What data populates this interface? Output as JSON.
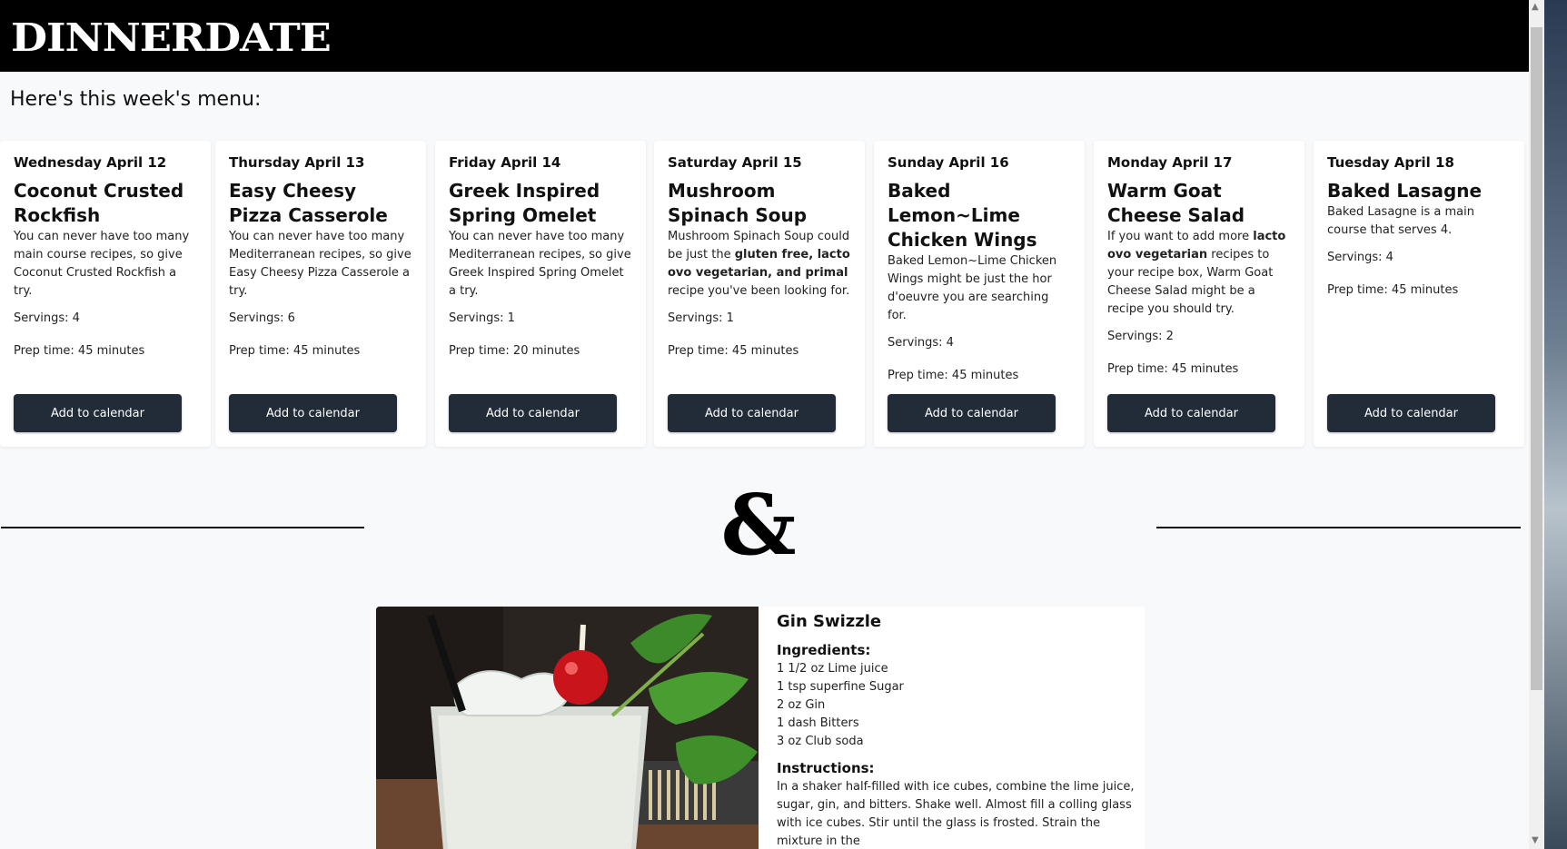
{
  "app": {
    "logo": "DINNERDATE"
  },
  "menu": {
    "heading": "Here's this week's menu:",
    "button_label": "Add to calendar",
    "cards": [
      {
        "day": "Wednesday April 12",
        "title": "Coconut Crusted Rockfish",
        "desc_html": "You can never have too many main course recipes, so give Coconut Crusted Rockfish a try.",
        "servings": "Servings: 4",
        "prep": "Prep time: 45 minutes"
      },
      {
        "day": "Thursday April 13",
        "title": "Easy Cheesy Pizza Casserole",
        "desc_html": "You can never have too many Mediterranean recipes, so give Easy Cheesy Pizza Casserole a try.",
        "servings": "Servings: 6",
        "prep": "Prep time: 45 minutes"
      },
      {
        "day": "Friday April 14",
        "title": "Greek Inspired Spring Omelet",
        "desc_html": "You can never have too many Mediterranean recipes, so give Greek Inspired Spring Omelet a try.",
        "servings": "Servings: 1",
        "prep": "Prep time: 20 minutes"
      },
      {
        "day": "Saturday April 15",
        "title": "Mushroom Spinach Soup",
        "desc_html": "Mushroom Spinach Soup could be just the <b>gluten free, lacto ovo vegetarian, and primal</b> recipe you've been looking for.",
        "servings": "Servings: 1",
        "prep": "Prep time: 45 minutes"
      },
      {
        "day": "Sunday April 16",
        "title": "Baked Lemon~Lime Chicken Wings",
        "desc_html": "Baked Lemon~Lime Chicken Wings might be just the hor d'oeuvre you are searching for.",
        "servings": "Servings: 4",
        "prep": "Prep time: 45 minutes"
      },
      {
        "day": "Monday April 17",
        "title": "Warm Goat Cheese Salad",
        "desc_html": "If you want to add more <b>lacto ovo vegetarian</b> recipes to your recipe box, Warm Goat Cheese Salad might be a recipe you should try.",
        "servings": "Servings: 2",
        "prep": "Prep time: 45 minutes"
      },
      {
        "day": "Tuesday April 18",
        "title": "Baked Lasagne",
        "desc_html": "Baked Lasagne is a main course that serves 4.",
        "servings": "Servings: 4",
        "prep": "Prep time: 45 minutes"
      }
    ]
  },
  "separator": {
    "symbol": "&"
  },
  "drink": {
    "name": "Gin Swizzle",
    "ingredients_label": "Ingredients:",
    "ingredients": [
      "1 1/2 oz Lime juice",
      "1 tsp superfine Sugar",
      "2 oz Gin",
      "1 dash Bitters",
      "3 oz Club soda"
    ],
    "instructions_label": "Instructions:",
    "instructions": "In a shaker half-filled with ice cubes, combine the lime juice, sugar, gin, and bitters. Shake well. Almost fill a colling glass with ice cubes. Stir until the glass is frosted. Strain the mixture in the"
  },
  "colors": {
    "header_bg": "#000000",
    "button_bg": "#222b38",
    "page_bg": "#f8f9fb"
  }
}
